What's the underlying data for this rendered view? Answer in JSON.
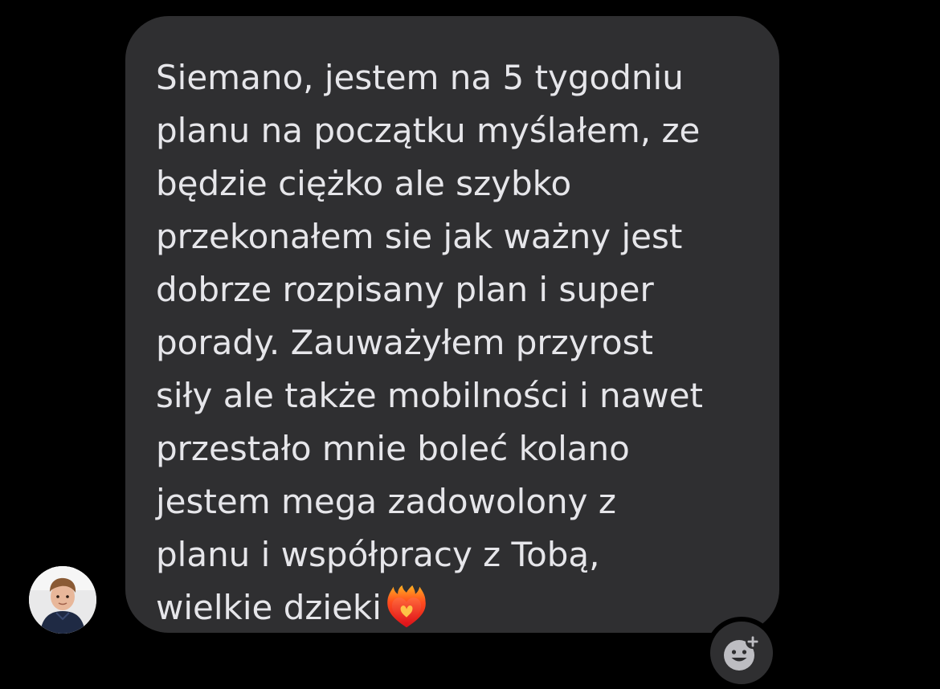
{
  "message": {
    "lines": [
      "Siemano, jestem na 5 tygodniu",
      "planu na początku myślałem, ze",
      "będzie ciężko ale szybko",
      "przekonałem sie jak ważny jest",
      "dobrze rozpisany plan i super",
      "porady. Zauważyłem przyrost",
      "siły ale także mobilności i nawet",
      "przestało mnie boleć kolano",
      "jestem mega zadowolony z",
      "planu i współpracy z Tobą,",
      "wielkie dzieki"
    ],
    "trailing_emoji": "heart-on-fire-icon"
  },
  "colors": {
    "background": "#000000",
    "bubble": "#2f2f31",
    "text": "#e6e6ea",
    "reaction_icon": "#bdbdc2"
  },
  "icons": {
    "avatar": "avatar",
    "reaction": "add-reaction-icon"
  }
}
